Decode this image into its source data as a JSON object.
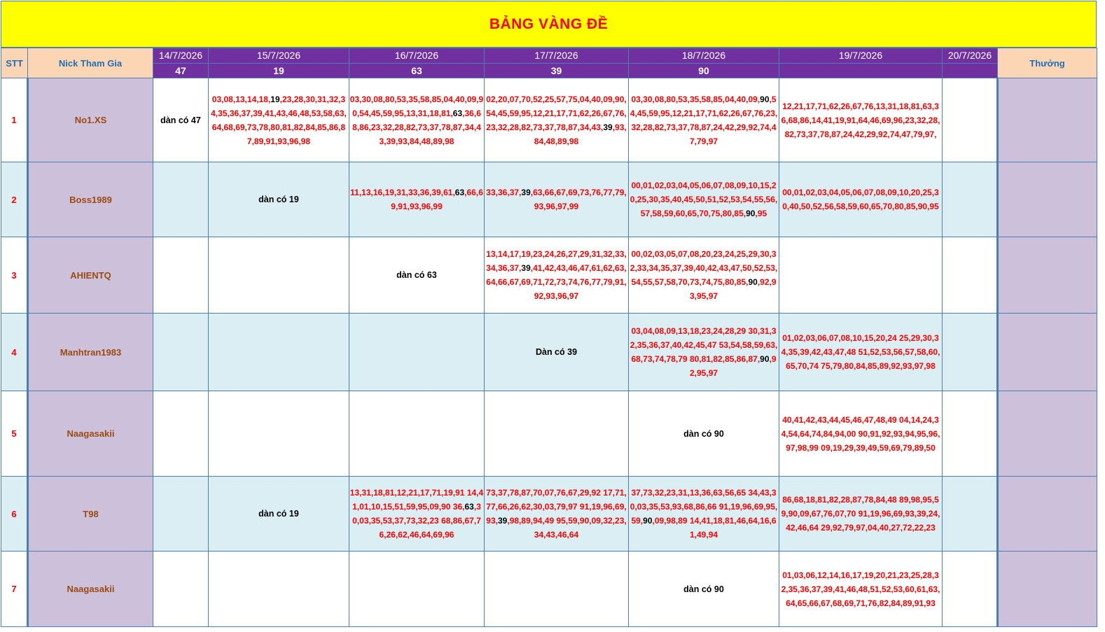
{
  "title": "BẢNG VÀNG ĐỀ",
  "headers": {
    "stt": "STT",
    "nick": "Nick Tham Gia",
    "reward": "Thưởng"
  },
  "dates": [
    {
      "date": "14/7/2026",
      "result": "47"
    },
    {
      "date": "15/7/2026",
      "result": "19"
    },
    {
      "date": "16/7/2026",
      "result": "63"
    },
    {
      "date": "17/7/2026",
      "result": "39"
    },
    {
      "date": "18/7/2026",
      "result": "90"
    },
    {
      "date": "19/7/2026",
      "result": ""
    },
    {
      "date": "20/7/2026",
      "result": ""
    }
  ],
  "rows": [
    {
      "stt": "1",
      "nick": "No1.XS",
      "reward": "",
      "cells": [
        {
          "text": "dàn có 47",
          "note": true
        },
        {
          "text": "03,08,13,14,18,19,23,28,30,31,32,34,35,36,37,39,41,43,46,48,53,58,63,64,68,69,73,78,80,81,82,84,85,86,87,89,91,93,96,98",
          "hit": "19"
        },
        {
          "text": "03,30,08,80,53,35,58,85,04,40,09,90,54,45,59,95,13,31,18,81,63,36,68,86,23,32,28,82,73,37,78,87,34,43,39,93,84,48,89,98",
          "hit": "63"
        },
        {
          "text": "02,20,07,70,52,25,57,75,04,40,09,90,54,45,59,95,12,21,17,71,62,26,67,76,23,32,28,82,73,37,78,87,34,43,39,93,84,48,89,98",
          "hit": "39"
        },
        {
          "text": "03,30,08,80,53,35,58,85,04,40,09,90,54,45,59,95,12,21,17,71,62,26,67,76,23,32,28,82,73,37,78,87,24,42,29,92,74,47,79,97",
          "hit": "90"
        },
        {
          "text": "12,21,17,71,62,26,67,76,13,31,18,81,63,36,68,86,14,41,19,91,64,46,69,96,23,32,28,82,73,37,78,87,24,42,29,92,74,47,79,97,",
          "hit": ""
        },
        {
          "text": "",
          "hit": ""
        }
      ]
    },
    {
      "stt": "2",
      "nick": "Boss1989",
      "reward": "",
      "cells": [
        {
          "text": "",
          "hit": ""
        },
        {
          "text": "dàn có 19",
          "note": true
        },
        {
          "text": "11,13,16,19,31,33,36,39,61,63,66,69,91,93,96,99",
          "hit": "63"
        },
        {
          "text": "33,36,37,39,63,66,67,69,73,76,77,79,93,96,97,99",
          "hit": "39"
        },
        {
          "text": "00,01,02,03,04,05,06,07,08,09,10,15,20,25,30,35,40,45,50,51,52,53,54,55,56,57,58,59,60,65,70,75,80,85,90,95",
          "hit": "90"
        },
        {
          "text": "00,01,02,03,04,05,06,07,08,09,10,20,25,30,40,50,52,56,58,59,60,65,70,80,85,90,95",
          "hit": ""
        },
        {
          "text": "",
          "hit": ""
        }
      ]
    },
    {
      "stt": "3",
      "nick": "AHIENTQ",
      "reward": "",
      "cells": [
        {
          "text": "",
          "hit": ""
        },
        {
          "text": "",
          "hit": ""
        },
        {
          "text": "dàn có 63",
          "note": true
        },
        {
          "text": "13,14,17,19,23,24,26,27,29,31,32,33,34,36,37,39,41,42,43,46,47,61,62,63,64,66,67,69,71,72,73,74,76,77,79,91,92,93,96,97",
          "hit": "39"
        },
        {
          "text": "00,02,03,05,07,08,20,23,24,25,29,30,32,33,34,35,37,39,40,42,43,47,50,52,53,54,55,57,58,70,73,74,75,80,85,90,92,93,95,97",
          "hit": "90"
        },
        {
          "text": "",
          "hit": ""
        },
        {
          "text": "",
          "hit": ""
        }
      ]
    },
    {
      "stt": "4",
      "nick": "Manhtran1983",
      "reward": "",
      "cells": [
        {
          "text": "",
          "hit": ""
        },
        {
          "text": "",
          "hit": ""
        },
        {
          "text": "",
          "hit": ""
        },
        {
          "text": "Dàn có 39",
          "note": true
        },
        {
          "text": "03,04,08,09,13,18,23,24,28,29 30,31,32,35,36,37,40,42,45,47 53,54,58,59,63,68,73,74,78,79 80,81,82,85,86,87,90,92,95,97",
          "hit": "90"
        },
        {
          "text": "01,02,03,06,07,08,10,15,20,24 25,29,30,34,35,39,42,43,47,48 51,52,53,56,57,58,60,65,70,74 75,79,80,84,85,89,92,93,97,98",
          "hit": ""
        },
        {
          "text": "",
          "hit": ""
        }
      ]
    },
    {
      "stt": "5",
      "nick": "Naagasakii",
      "reward": "",
      "cells": [
        {
          "text": "",
          "hit": ""
        },
        {
          "text": "",
          "hit": ""
        },
        {
          "text": "",
          "hit": ""
        },
        {
          "text": "",
          "hit": ""
        },
        {
          "text": "dàn có 90",
          "note": true
        },
        {
          "text": "40,41,42,43,44,45,46,47,48,49 04,14,24,34,54,64,74,84,94,00 90,91,92,93,94,95,96,97,98,99 09,19,29,39,49,59,69,79,89,50",
          "hit": ""
        },
        {
          "text": "",
          "hit": ""
        }
      ]
    },
    {
      "stt": "6",
      "nick": "T98",
      "reward": "",
      "cells": [
        {
          "text": "",
          "hit": ""
        },
        {
          "text": "dàn có 19",
          "note": true
        },
        {
          "text": "13,31,18,81,12,21,17,71,19,91 14,41,01,10,15,51,59,95,09,90 36,63,30,03,35,53,37,73,32,23 68,86,67,76,26,62,46,64,69,96",
          "hit": "63"
        },
        {
          "text": "73,37,78,87,70,07,76,67,29,92 17,71,77,66,26,62,30,03,79,97 91,19,96,69,93,39,98,89,94,49 95,59,90,09,32,23,34,43,46,64",
          "hit": "39"
        },
        {
          "text": "37,73,32,23,31,13,36,63,56,65 34,43,30,03,35,53,93,68,86,66 91,19,96,69,95,59,90,09,98,89 14,41,18,81,46,64,16,61,49,94",
          "hit": "90"
        },
        {
          "text": "86,68,18,81,82,28,87,78,84,48 89,98,95,59,90,09,67,76,07,70 91,19,96,69,93,39,24,42,46,64 29,92,79,97,04,40,27,72,22,23",
          "hit": ""
        },
        {
          "text": "",
          "hit": ""
        }
      ]
    },
    {
      "stt": "7",
      "nick": "Naagasakii",
      "reward": "",
      "cells": [
        {
          "text": "",
          "hit": ""
        },
        {
          "text": "",
          "hit": ""
        },
        {
          "text": "",
          "hit": ""
        },
        {
          "text": "",
          "hit": ""
        },
        {
          "text": "dàn có 90",
          "note": true
        },
        {
          "text": "01,03,06,12,14,16,17,19,20,21,23,25,28,32,35,36,37,39,41,46,48,51,52,53,60,61,63,64,65,66,67,68,69,71,76,82,84,89,91,93",
          "hit": ""
        },
        {
          "text": "",
          "hit": ""
        }
      ]
    }
  ]
}
